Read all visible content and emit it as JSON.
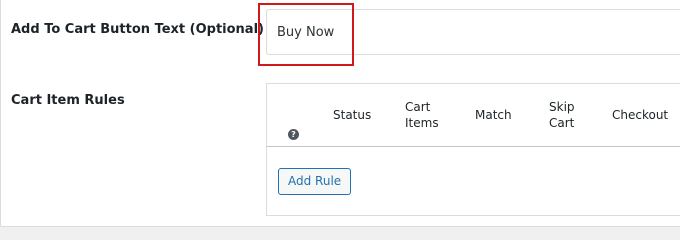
{
  "fields": {
    "cart_button_text": {
      "label": "Add To Cart Button Text (Optional)",
      "value": "Buy Now"
    },
    "cart_item_rules": {
      "label": "Cart Item Rules"
    }
  },
  "rules_table": {
    "help_icon_glyph": "?",
    "columns": {
      "status": "Status",
      "cart_items": "Cart\nItems",
      "match": "Match",
      "skip_cart": "Skip\nCart",
      "checkout": "Checkout"
    },
    "add_rule_label": "Add Rule"
  },
  "colors": {
    "highlight": "#d0191c",
    "accent": "#2271b1"
  }
}
